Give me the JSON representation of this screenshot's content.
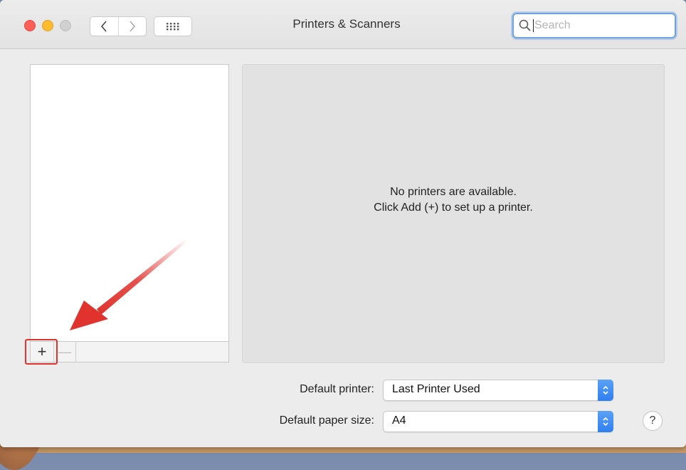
{
  "window": {
    "title": "Printers & Scanners",
    "search": {
      "placeholder": "Search",
      "value": ""
    },
    "nav": {
      "back_icon": "chevron-left-icon",
      "forward_icon": "chevron-right-icon",
      "grid_icon": "grid-icon"
    }
  },
  "printer_list": {
    "items": [],
    "add_label": "+",
    "remove_label": "—"
  },
  "detail": {
    "message_line1": "No printers are available.",
    "message_line2": "Click Add (+) to set up a printer."
  },
  "settings": {
    "default_printer_label": "Default printer:",
    "default_printer_value": "Last Printer Used",
    "default_paper_label": "Default paper size:",
    "default_paper_value": "A4"
  },
  "help_label": "?",
  "colors": {
    "annotation": "#e0332e",
    "accent": "#2f7ff0",
    "traffic_red": "#fc5f57",
    "traffic_yellow": "#fdbc2e"
  }
}
